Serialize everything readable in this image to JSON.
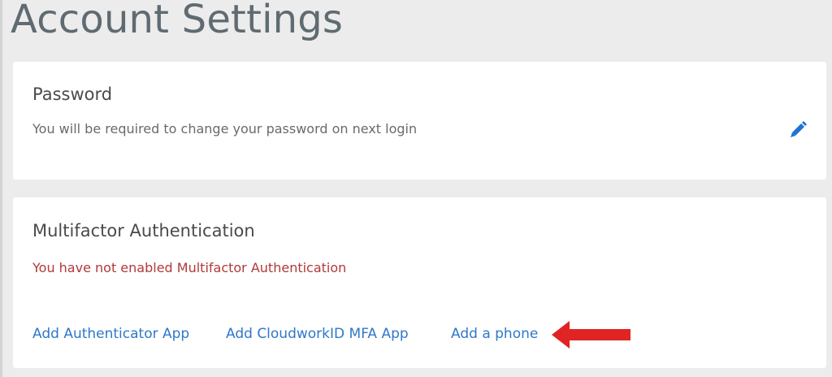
{
  "page": {
    "title": "Account Settings"
  },
  "password_card": {
    "heading": "Password",
    "message": "You will be required to change your password on next login",
    "edit_icon": "pencil-icon"
  },
  "mfa_card": {
    "heading": "Multifactor Authentication",
    "status": "You have not enabled Multifactor Authentication",
    "links": [
      {
        "label": "Add Authenticator App"
      },
      {
        "label": "Add CloudworkID MFA App"
      },
      {
        "label": "Add a phone"
      }
    ],
    "annotation_icon": "arrow-left-icon"
  },
  "colors": {
    "background": "#ececec",
    "card": "#ffffff",
    "title": "#5f6b70",
    "link": "#2f78c8",
    "warning": "#b03a3a",
    "edit_icon": "#1e74d6",
    "arrow": "#e02424"
  }
}
